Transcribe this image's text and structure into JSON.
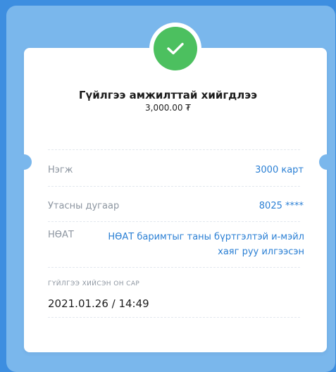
{
  "result": {
    "title": "Гүйлгээ амжилттай хийгдлээ",
    "amount": "3,000.00 ₮"
  },
  "details": {
    "quantity_label": "Нэгж",
    "quantity_value": "3000 карт",
    "phone_label": "Утасны дугаар",
    "phone_value": "8025 ****",
    "vat_label": "НӨАТ",
    "vat_value": "НӨАТ баримтыг таны бүртгэлтэй и-мэйл хаяг руу илгээсэн"
  },
  "transaction": {
    "date_label": "ГҮЙЛГЭЭ ХИЙСЭН ОН САР",
    "date_value": "2021.01.26 / 14:49"
  },
  "colors": {
    "background": "#3d8ee0",
    "panel": "#7ab7ec",
    "success": "#4cc05f",
    "accent_text": "#2a7fd4"
  },
  "icons": {
    "status": "check-icon"
  }
}
